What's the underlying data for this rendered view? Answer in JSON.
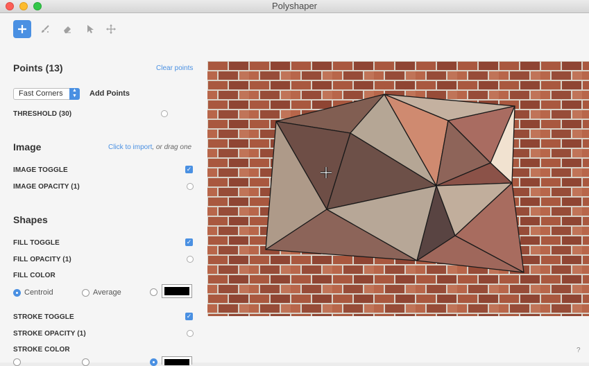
{
  "window": {
    "title": "Polyshaper"
  },
  "colors": {
    "accent": "#4a90e2",
    "fill_color": "#000000",
    "stroke_color": "#000000"
  },
  "toolbar": {
    "tools": [
      {
        "name": "add-point-tool",
        "icon": "plus-icon",
        "active": true
      },
      {
        "name": "brush-tool",
        "icon": "brush-icon",
        "active": false
      },
      {
        "name": "eraser-tool",
        "icon": "eraser-icon",
        "active": false
      },
      {
        "name": "select-tool",
        "icon": "pointer-icon",
        "active": false
      },
      {
        "name": "move-tool",
        "icon": "move-icon",
        "active": false
      }
    ]
  },
  "points": {
    "title": "Points (13)",
    "clear_label": "Clear points",
    "method_value": "Fast Corners",
    "add_label": "Add Points",
    "threshold_label": "THRESHOLD (30)"
  },
  "image": {
    "title": "Image",
    "import_link": "Click to import",
    "import_suffix": ", or drag one",
    "toggle_label": "IMAGE TOGGLE",
    "toggle_on": true,
    "opacity_label": "IMAGE OPACITY (1)"
  },
  "shapes": {
    "title": "Shapes",
    "fill_toggle_label": "FILL TOGGLE",
    "fill_toggle_on": true,
    "fill_opacity_label": "FILL OPACITY (1)",
    "fill_color_label": "FILL COLOR",
    "fill_mode_options": [
      "Centroid",
      "Average"
    ],
    "fill_mode_selected": "Centroid",
    "stroke_toggle_label": "STROKE TOGGLE",
    "stroke_toggle_on": true,
    "stroke_opacity_label": "STROKE OPACITY (1)",
    "stroke_color_label": "STROKE COLOR"
  },
  "help": {
    "label": "?"
  }
}
